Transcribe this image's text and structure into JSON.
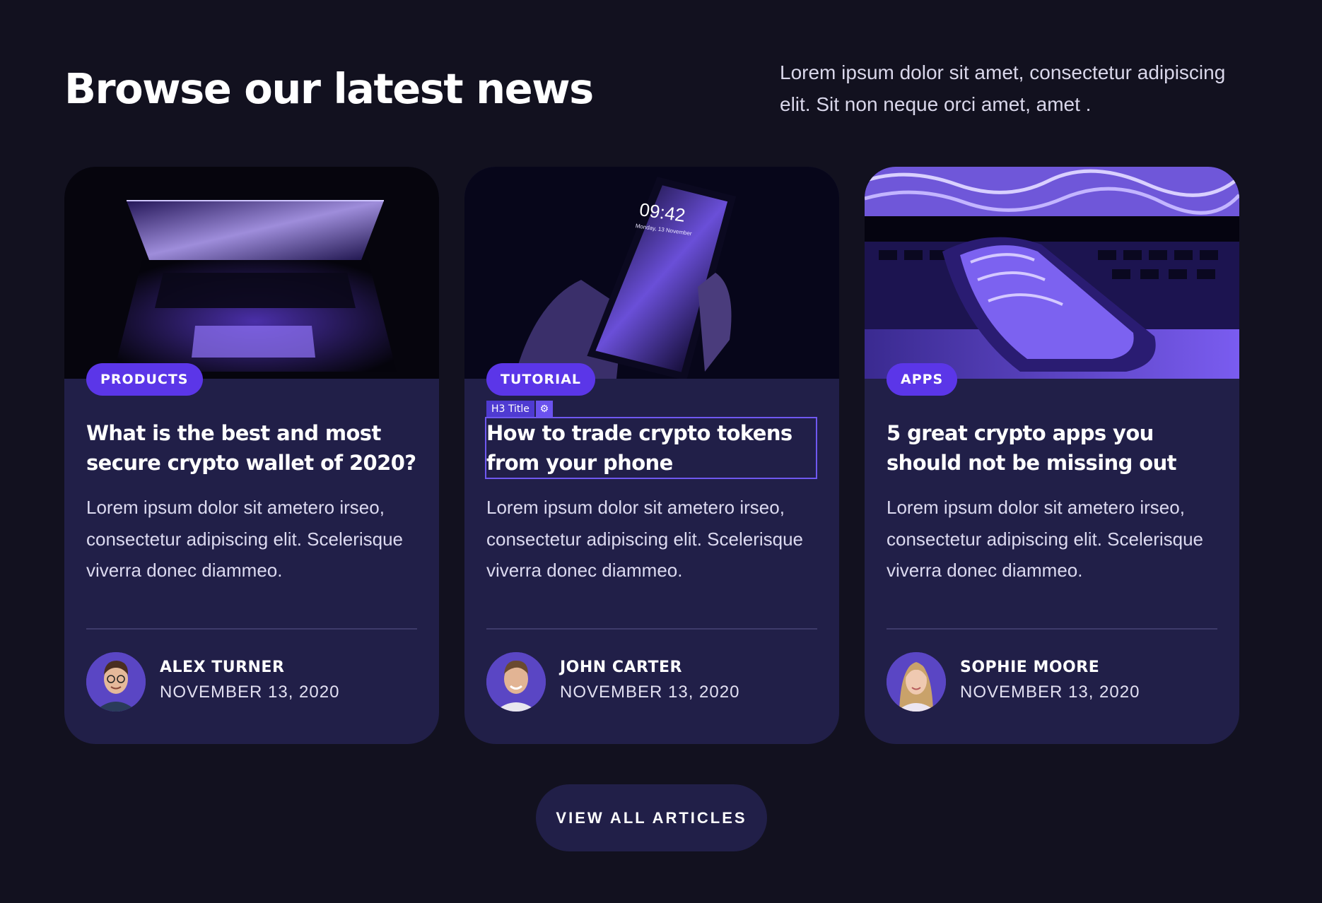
{
  "header": {
    "title": "Browse our latest news",
    "intro": "Lorem ipsum dolor sit amet, consectetur adipiscing elit. Sit non neque orci amet, amet ."
  },
  "cards": [
    {
      "tag": "PRODUCTS",
      "title": "What is the best and most secure crypto wallet of 2020?",
      "body": "Lorem ipsum dolor sit ametero irseo, consectetur adipiscing elit. Scelerisque viverra donec diammeo.",
      "author": "ALEX TURNER",
      "date": "NOVEMBER 13, 2020"
    },
    {
      "tag": "TUTORIAL",
      "title": "How to trade crypto tokens from your phone",
      "body": "Lorem ipsum dolor sit ametero irseo, consectetur adipiscing elit. Scelerisque viverra donec diammeo.",
      "author": "JOHN CARTER",
      "date": "NOVEMBER 13, 2020",
      "phone_time": "09:42",
      "phone_date": "Monday, 13 November"
    },
    {
      "tag": "APPS",
      "title": "5 great crypto apps you should not be missing out",
      "body": "Lorem ipsum dolor sit ametero irseo, consectetur adipiscing elit. Scelerisque viverra donec diammeo.",
      "author": "SOPHIE MOORE",
      "date": "NOVEMBER 13, 2020"
    }
  ],
  "editor_chip": {
    "label": "H3 Title",
    "icon": "gear-icon"
  },
  "cta": {
    "label": "VIEW ALL ARTICLES"
  },
  "colors": {
    "background": "#12111f",
    "card": "#211f48",
    "accent": "#5b36e8"
  }
}
